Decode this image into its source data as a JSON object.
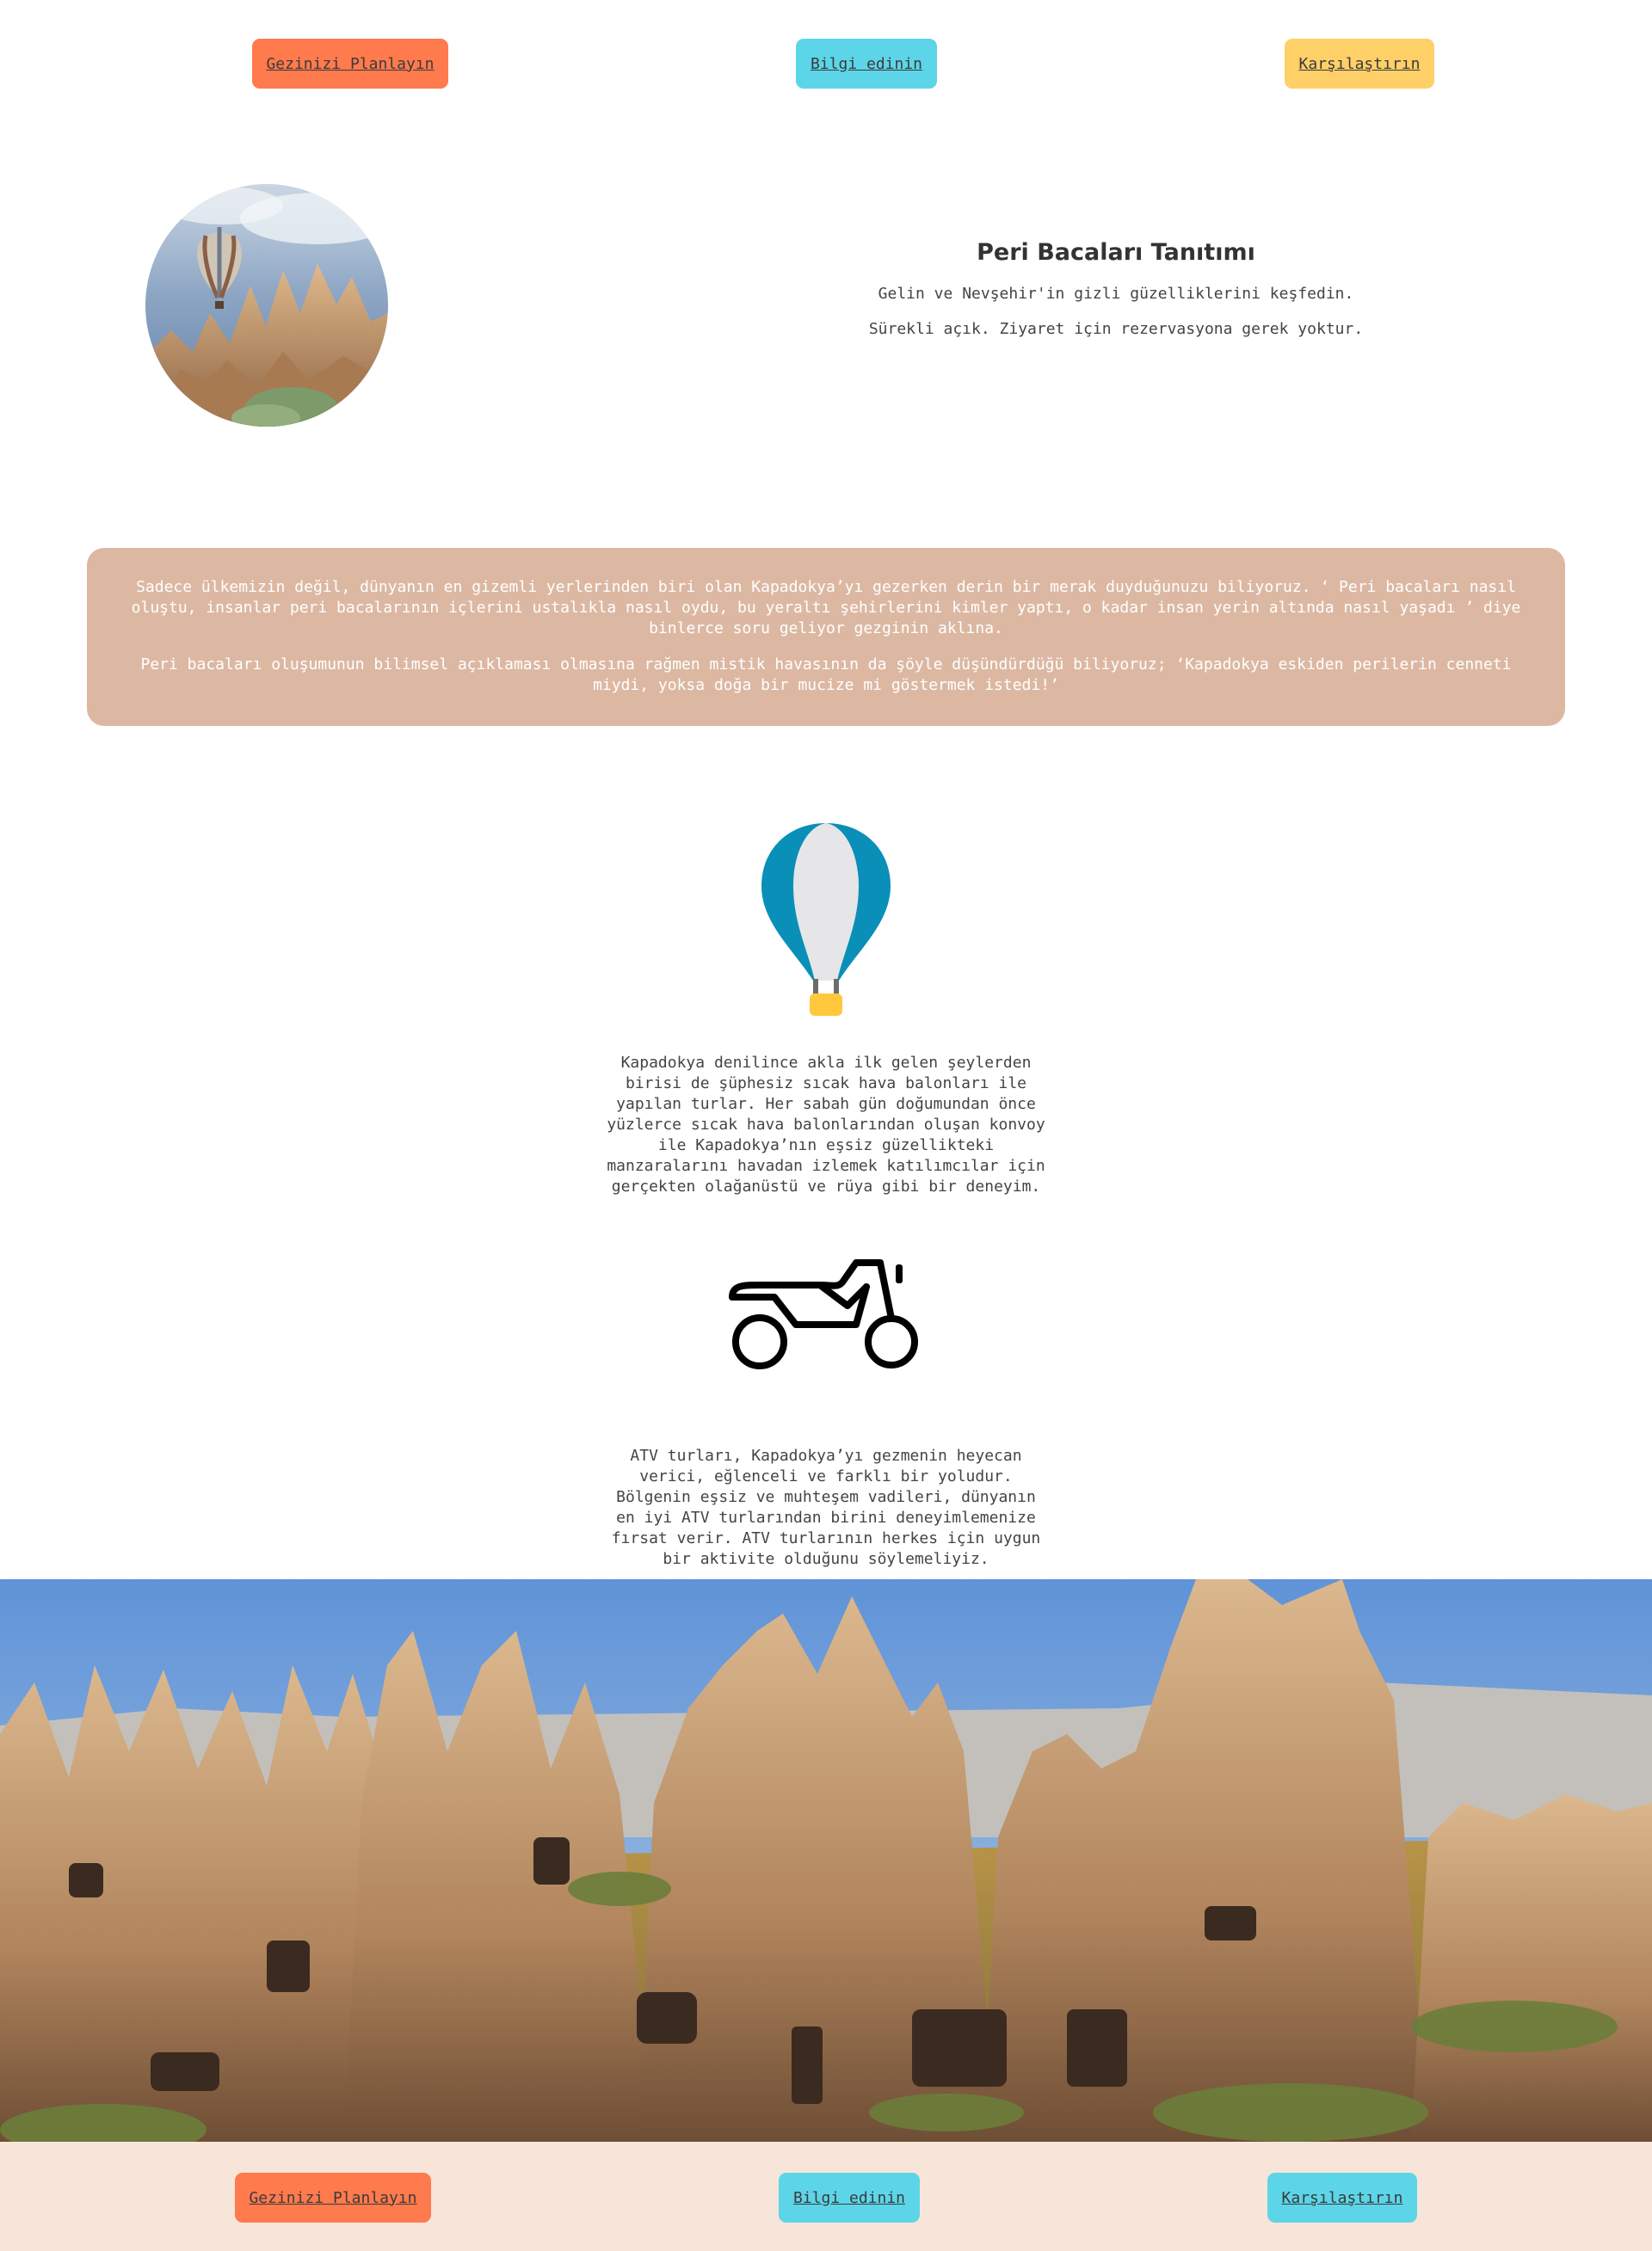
{
  "colors": {
    "accent_orange": "#ff7a4d",
    "accent_cyan": "#5dd5e8",
    "accent_yellow": "#ffd068",
    "panel_tan": "#dcb8a3",
    "footer_bg": "#f8e5da",
    "balloon_blue": "#0a8fb8",
    "balloon_grey": "#e6e6e8",
    "balloon_basket": "#ffc83d"
  },
  "top_nav": {
    "plan_label": "Gezinizi Planlayın",
    "info_label": "Bilgi edinin",
    "compare_label": "Karşılaştırın"
  },
  "hero": {
    "title": "Peri Bacaları Tanıtımı",
    "line1": "Gelin ve Nevşehir'in gizli güzelliklerini keşfedin.",
    "line2": "Sürekli açık. Ziyaret için rezervasyona gerek yoktur.",
    "photo_icon": "balloon-over-fairy-chimneys-photo"
  },
  "intro": {
    "paragraph1": "Sadece ülkemizin değil, dünyanın en gizemli yerlerinden biri olan Kapadokya’yı gezerken derin bir merak duyduğunuzu biliyoruz. ‘ Peri bacaları nasıl oluştu, insanlar peri bacalarının içlerini ustalıkla nasıl oydu, bu yeraltı şehirlerini kimler yaptı, o kadar insan yerin altında nasıl yaşadı ’ diye binlerce soru geliyor gezginin aklına.",
    "paragraph2": "Peri bacaları oluşumunun bilimsel açıklaması olmasına rağmen mistik havasının da şöyle düşündürdüğü biliyoruz; ‘Kapadokya eskiden perilerin cenneti miydi, yoksa doğa bir mucize mi göstermek istedi!’"
  },
  "features": {
    "balloon": {
      "icon": "hot-air-balloon-icon",
      "text": "Kapadokya denilince akla ilk gelen şeylerden birisi de şüphesiz sıcak hava balonları ile yapılan turlar. Her sabah gün doğumundan önce yüzlerce sıcak hava balonlarından oluşan konvoy ile Kapadokya’nın eşsiz güzellikteki manzaralarını havadan izlemek katılımcılar için gerçekten olağanüstü ve rüya gibi bir deneyim."
    },
    "atv": {
      "icon": "motorcycle-icon",
      "text": "ATV turları, Kapadokya’yı gezmenin heyecan verici, eğlenceli ve farklı bir yoludur. Bölgenin eşsiz ve muhteşem vadileri, dünyanın en iyi ATV turlarından birini deneyimlemenize fırsat verir. ATV turlarının herkes için uygun bir aktivite olduğunu söylemeliyiz."
    }
  },
  "landscape": {
    "icon": "fairy-chimneys-landscape-photo"
  },
  "footer_nav": {
    "plan_label": "Gezinizi Planlayın",
    "info_label": "Bilgi edinin",
    "compare_label": "Karşılaştırın"
  }
}
